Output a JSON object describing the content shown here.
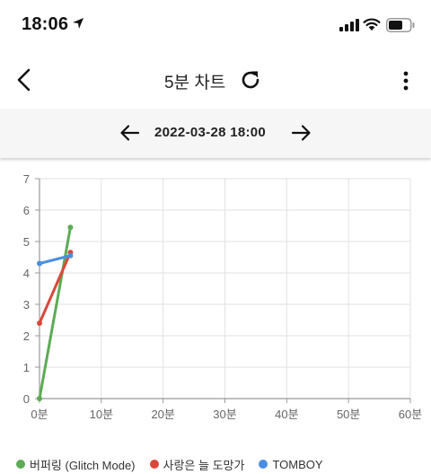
{
  "status_bar": {
    "time": "18:06"
  },
  "nav": {
    "title": "5분 차트"
  },
  "date_nav": {
    "date": "2022-03-28 18:00"
  },
  "chart_data": {
    "type": "line",
    "title": "",
    "xlabel": "",
    "ylabel": "",
    "x_ticks": [
      "0분",
      "10분",
      "20분",
      "30분",
      "40분",
      "50분",
      "60분"
    ],
    "y_ticks": [
      "0",
      "1",
      "2",
      "3",
      "4",
      "5",
      "6",
      "7"
    ],
    "xlim": [
      0,
      60
    ],
    "ylim": [
      0,
      7
    ],
    "grid": true,
    "legend_position": "bottom-left",
    "series": [
      {
        "name": "버퍼링 (Glitch Mode)",
        "color": "#5cab55",
        "x": [
          0,
          5
        ],
        "y": [
          0,
          5.45
        ]
      },
      {
        "name": "사랑은 늘 도망가",
        "color": "#d9483b",
        "x": [
          0,
          5
        ],
        "y": [
          2.4,
          4.65
        ]
      },
      {
        "name": "TOMBOY",
        "color": "#4a8fe0",
        "x": [
          0,
          5
        ],
        "y": [
          4.3,
          4.55
        ]
      }
    ]
  }
}
